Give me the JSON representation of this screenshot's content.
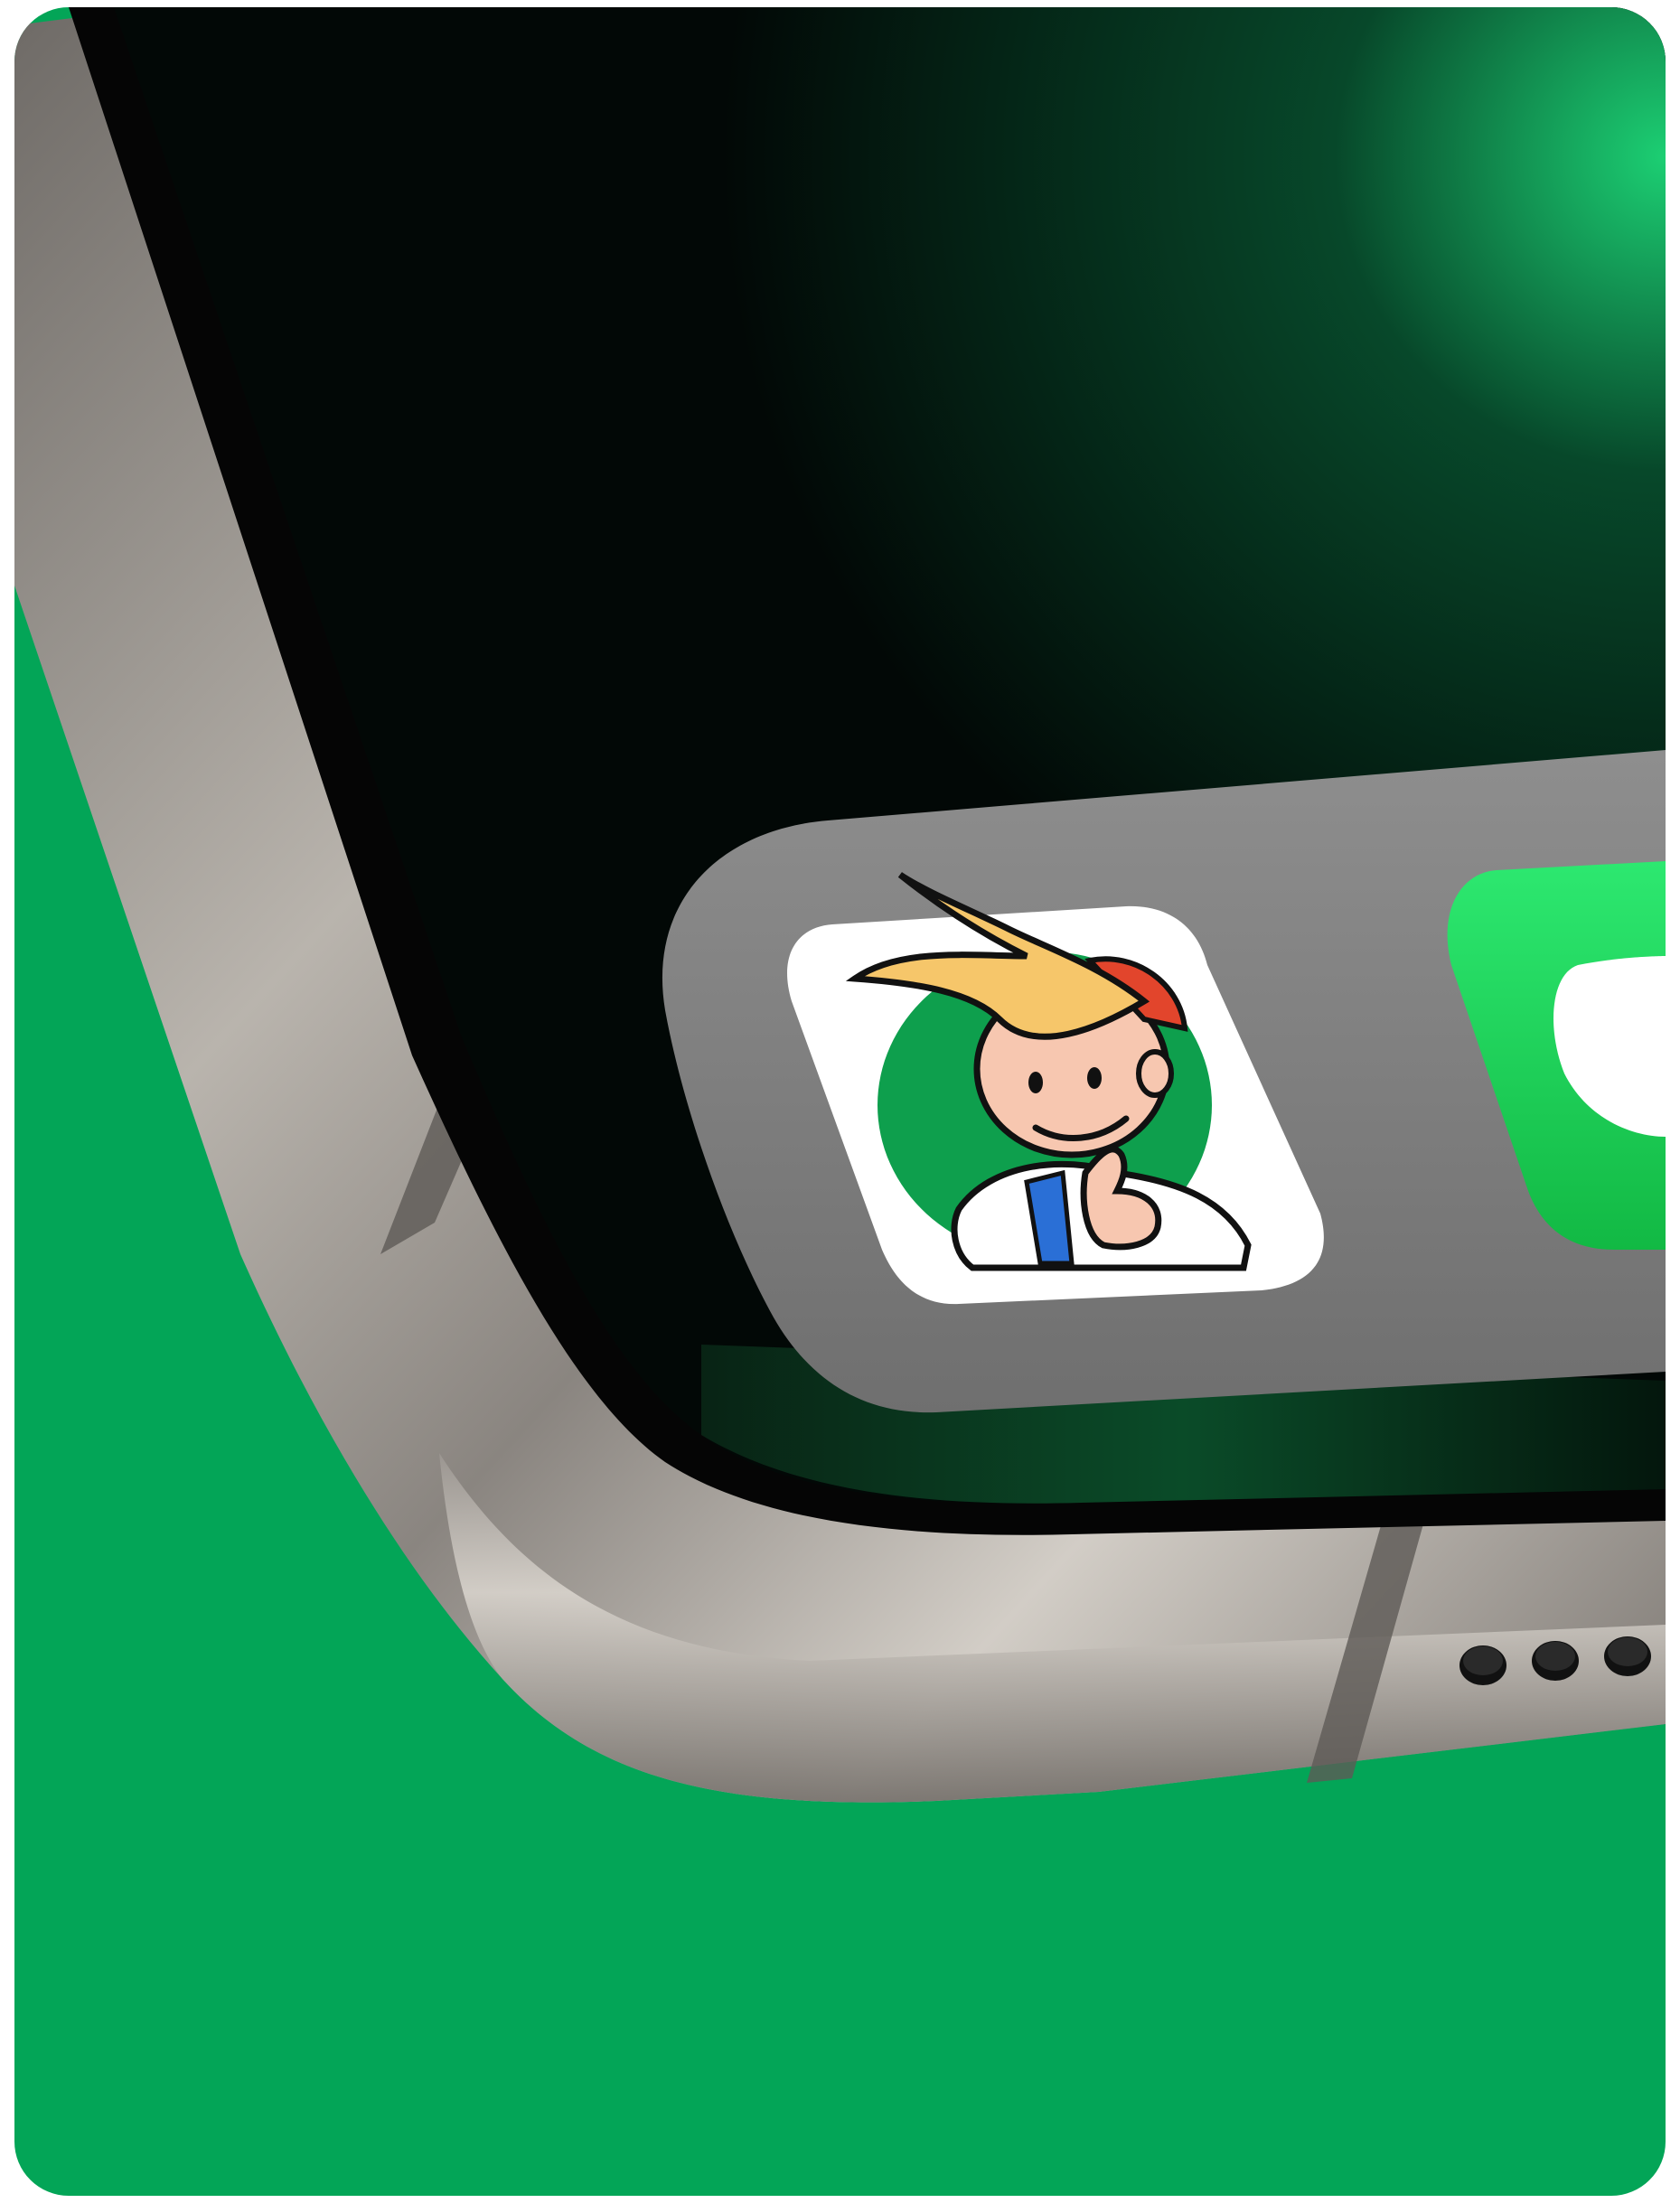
{
  "scene": {
    "subject": "phone-corner-closeup",
    "colors": {
      "background": "#03a557",
      "screen": "#020806",
      "screen_glow": "#0fa35a",
      "frame_light": "#c9c4bd",
      "frame_mid": "#8a8580",
      "frame_dark": "#4a4642",
      "dock": "#8c8c8c",
      "app_icon_bg": "#ffffff",
      "app_icon_circle": "#0e9f4d",
      "messages_icon": "#1ed85a"
    },
    "icons": [
      "character-app-icon",
      "messages-app-icon",
      "speaker-grille-icon"
    ]
  }
}
